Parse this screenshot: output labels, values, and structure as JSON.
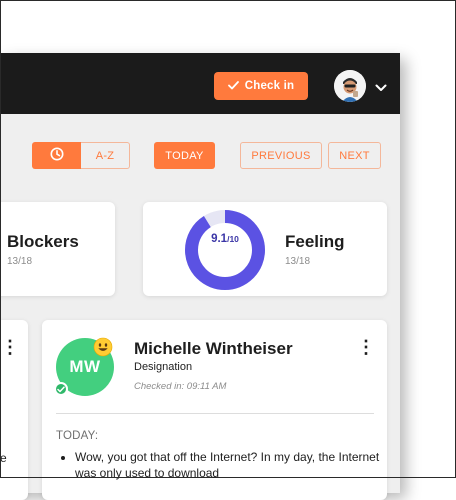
{
  "header": {
    "checkin_label": "Check in",
    "accent_color": "#ff7a3d",
    "bar_color": "#1b1b1b"
  },
  "toolbar": {
    "sort_time_icon": "clock-icon",
    "sort_az_label": "A-Z",
    "today_label": "TODAY",
    "previous_label": "PREVIOUS",
    "next_label": "NEXT"
  },
  "stats": {
    "blockers": {
      "title": "Blockers",
      "count": "13/18"
    },
    "feeling": {
      "title": "Feeling",
      "count": "13/18",
      "score": "9.1",
      "denominator": "/10",
      "ring_fill_fraction": 0.91,
      "ring_color": "#5b52e3",
      "ring_track_color": "#e6e6f4"
    }
  },
  "update_card": {
    "initials": "MW",
    "avatar_color": "#43cf7f",
    "mood_icon": "smiley-emoji-icon",
    "status_icon": "check-badge-icon",
    "name": "Michelle Wintheiser",
    "designation": "Designation",
    "checked_in": "Checked in: 09:11 AM",
    "section_label": "TODAY:",
    "items": [
      "Wow, you got that off the Internet? In my day, the Internet was only used to download"
    ]
  },
  "left_card": {
    "fragment": "e"
  }
}
